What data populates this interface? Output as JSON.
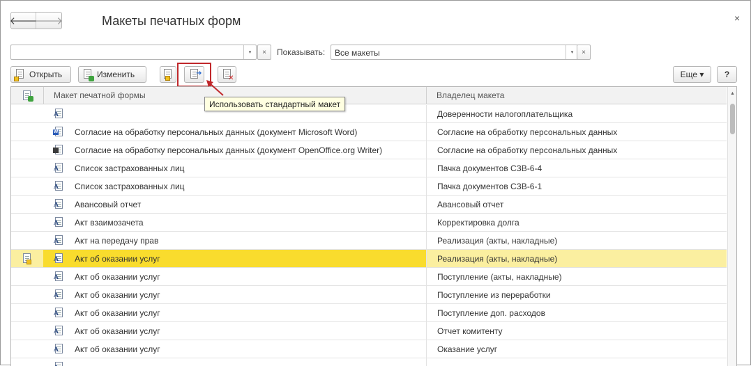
{
  "window": {
    "title": "Макеты печатных форм",
    "close_glyph": "×"
  },
  "nav": {
    "back_glyph": "🡐",
    "forward_glyph": "🡒"
  },
  "filter": {
    "search_value": "",
    "dropdown_glyph": "▾",
    "clear_glyph": "×",
    "show_label": "Показывать:",
    "show_value": "Все макеты"
  },
  "toolbar": {
    "open_label": "Открыть",
    "edit_label": "Изменить",
    "more_label": "Еще ▾",
    "help_label": "?",
    "tooltip": "Использовать стандартный макет"
  },
  "grid": {
    "columns": [
      "Макет печатной формы",
      "Владелец макета"
    ],
    "rows": [
      {
        "icon": "document-template-icon",
        "template": "",
        "owner": "Доверенности налогоплательщика",
        "selected": false
      },
      {
        "icon": "word-document-icon",
        "template": "Согласие на обработку персональных данных (документ Microsoft Word)",
        "owner": "Согласие на обработку персональных данных",
        "selected": false
      },
      {
        "icon": "writer-document-icon",
        "template": "Согласие на обработку персональных данных (документ OpenOffice.org Writer)",
        "owner": "Согласие на обработку персональных данных",
        "selected": false
      },
      {
        "icon": "document-template-icon",
        "template": "Список застрахованных лиц",
        "owner": "Пачка документов СЗВ-6-4",
        "selected": false
      },
      {
        "icon": "document-template-icon",
        "template": "Список застрахованных лиц",
        "owner": "Пачка документов СЗВ-6-1",
        "selected": false
      },
      {
        "icon": "document-template-icon",
        "template": "Авансовый отчет",
        "owner": "Авансовый отчет",
        "selected": false
      },
      {
        "icon": "document-template-icon",
        "template": "Акт взаимозачета",
        "owner": "Корректировка долга",
        "selected": false
      },
      {
        "icon": "document-template-icon",
        "template": "Акт на передачу прав",
        "owner": "Реализация (акты, накладные)",
        "selected": false
      },
      {
        "icon": "document-template-icon",
        "template": "Акт об оказании услуг",
        "owner": "Реализация (акты, накладные)",
        "selected": true
      },
      {
        "icon": "document-template-icon",
        "template": "Акт об оказании услуг",
        "owner": "Поступление (акты, накладные)",
        "selected": false
      },
      {
        "icon": "document-template-icon",
        "template": "Акт об оказании услуг",
        "owner": "Поступление из переработки",
        "selected": false
      },
      {
        "icon": "document-template-icon",
        "template": "Акт об оказании услуг",
        "owner": "Поступление доп. расходов",
        "selected": false
      },
      {
        "icon": "document-template-icon",
        "template": "Акт об оказании услуг",
        "owner": "Отчет комитенту",
        "selected": false
      },
      {
        "icon": "document-template-icon",
        "template": "Акт об оказании услуг",
        "owner": "Оказание услуг",
        "selected": false
      },
      {
        "icon": "document-template-icon",
        "template": "",
        "owner": "",
        "selected": false
      }
    ]
  },
  "colors": {
    "selected_row": "#f9dc2d",
    "selected_row_light": "#fbefa0",
    "highlight_border": "#c0282b",
    "tooltip_bg": "#ffffe1"
  }
}
